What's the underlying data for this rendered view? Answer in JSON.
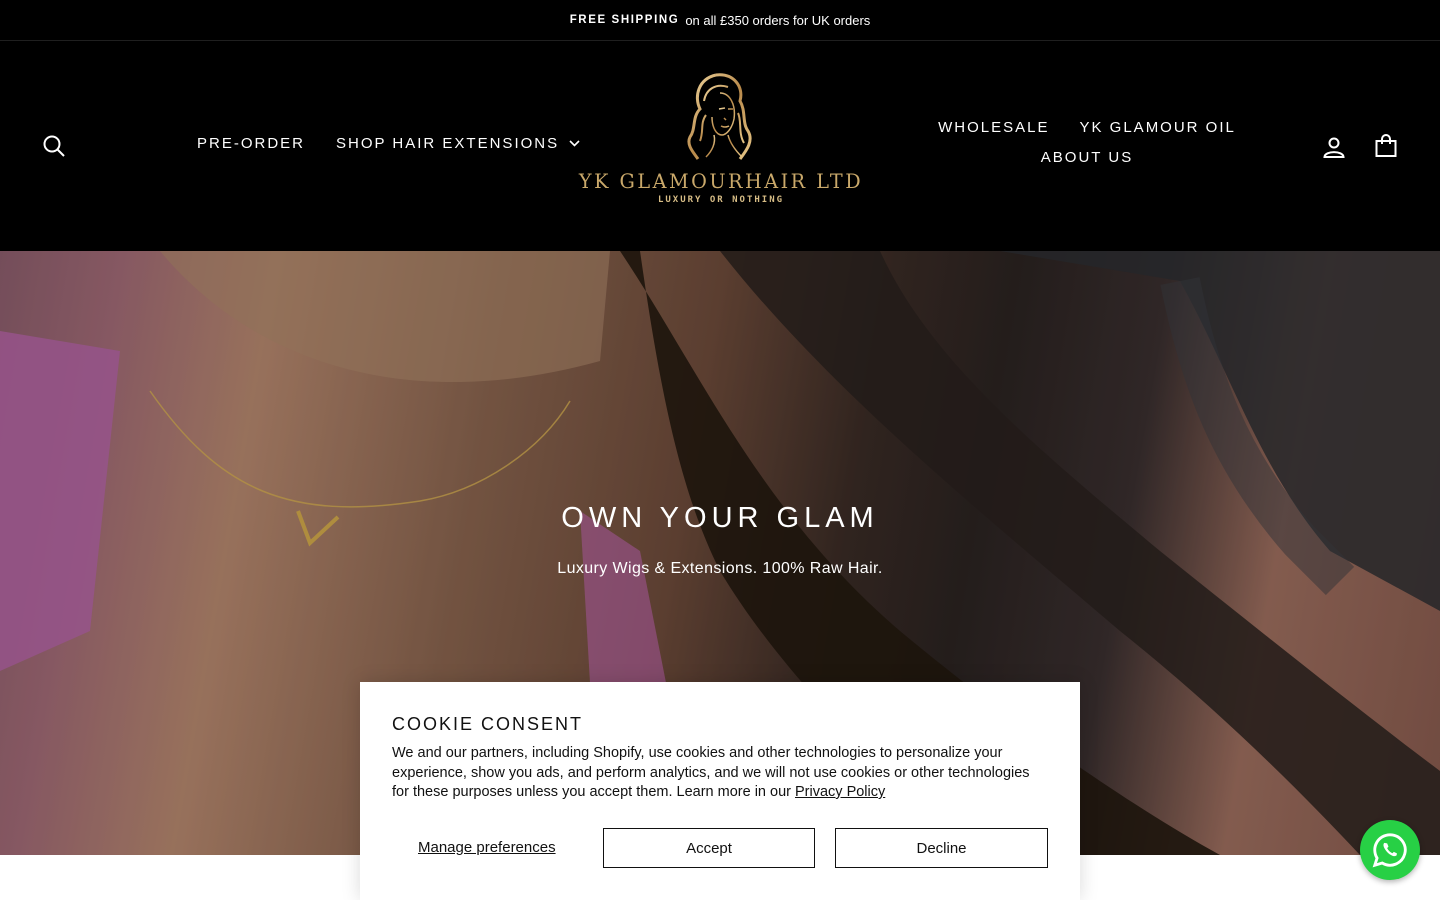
{
  "announcement": {
    "bold": "FREE SHIPPING",
    "text": "on all £350 orders for UK orders"
  },
  "header": {
    "nav_left": [
      {
        "label": "PRE-ORDER"
      },
      {
        "label": "SHOP HAIR EXTENSIONS",
        "has_dropdown": true
      }
    ],
    "nav_right": [
      {
        "label": "WHOLESALE"
      },
      {
        "label": "YK GLAMOUR OIL"
      },
      {
        "label": "ABOUT US"
      }
    ],
    "logo": {
      "name": "YK GLAMOURHAIR LTD",
      "tagline": "LUXURY OR NOTHING",
      "color": "#c9a86a"
    },
    "icons": {
      "search": "search-icon",
      "account": "user-icon",
      "cart": "bag-icon"
    }
  },
  "hero": {
    "title": "OWN YOUR GLAM",
    "subtitle": "Luxury Wigs & Extensions. 100% Raw Hair."
  },
  "cookie": {
    "title": "COOKIE CONSENT",
    "body": "We and our partners, including Shopify, use cookies and other technologies to personalize your experience, show you ads, and perform analytics, and we will not use cookies or other technologies for these purposes unless you accept them. Learn more in our ",
    "link": "Privacy Policy",
    "manage": "Manage preferences",
    "accept": "Accept",
    "decline": "Decline"
  },
  "whatsapp": {
    "icon": "whatsapp-icon",
    "color": "#27d045"
  }
}
